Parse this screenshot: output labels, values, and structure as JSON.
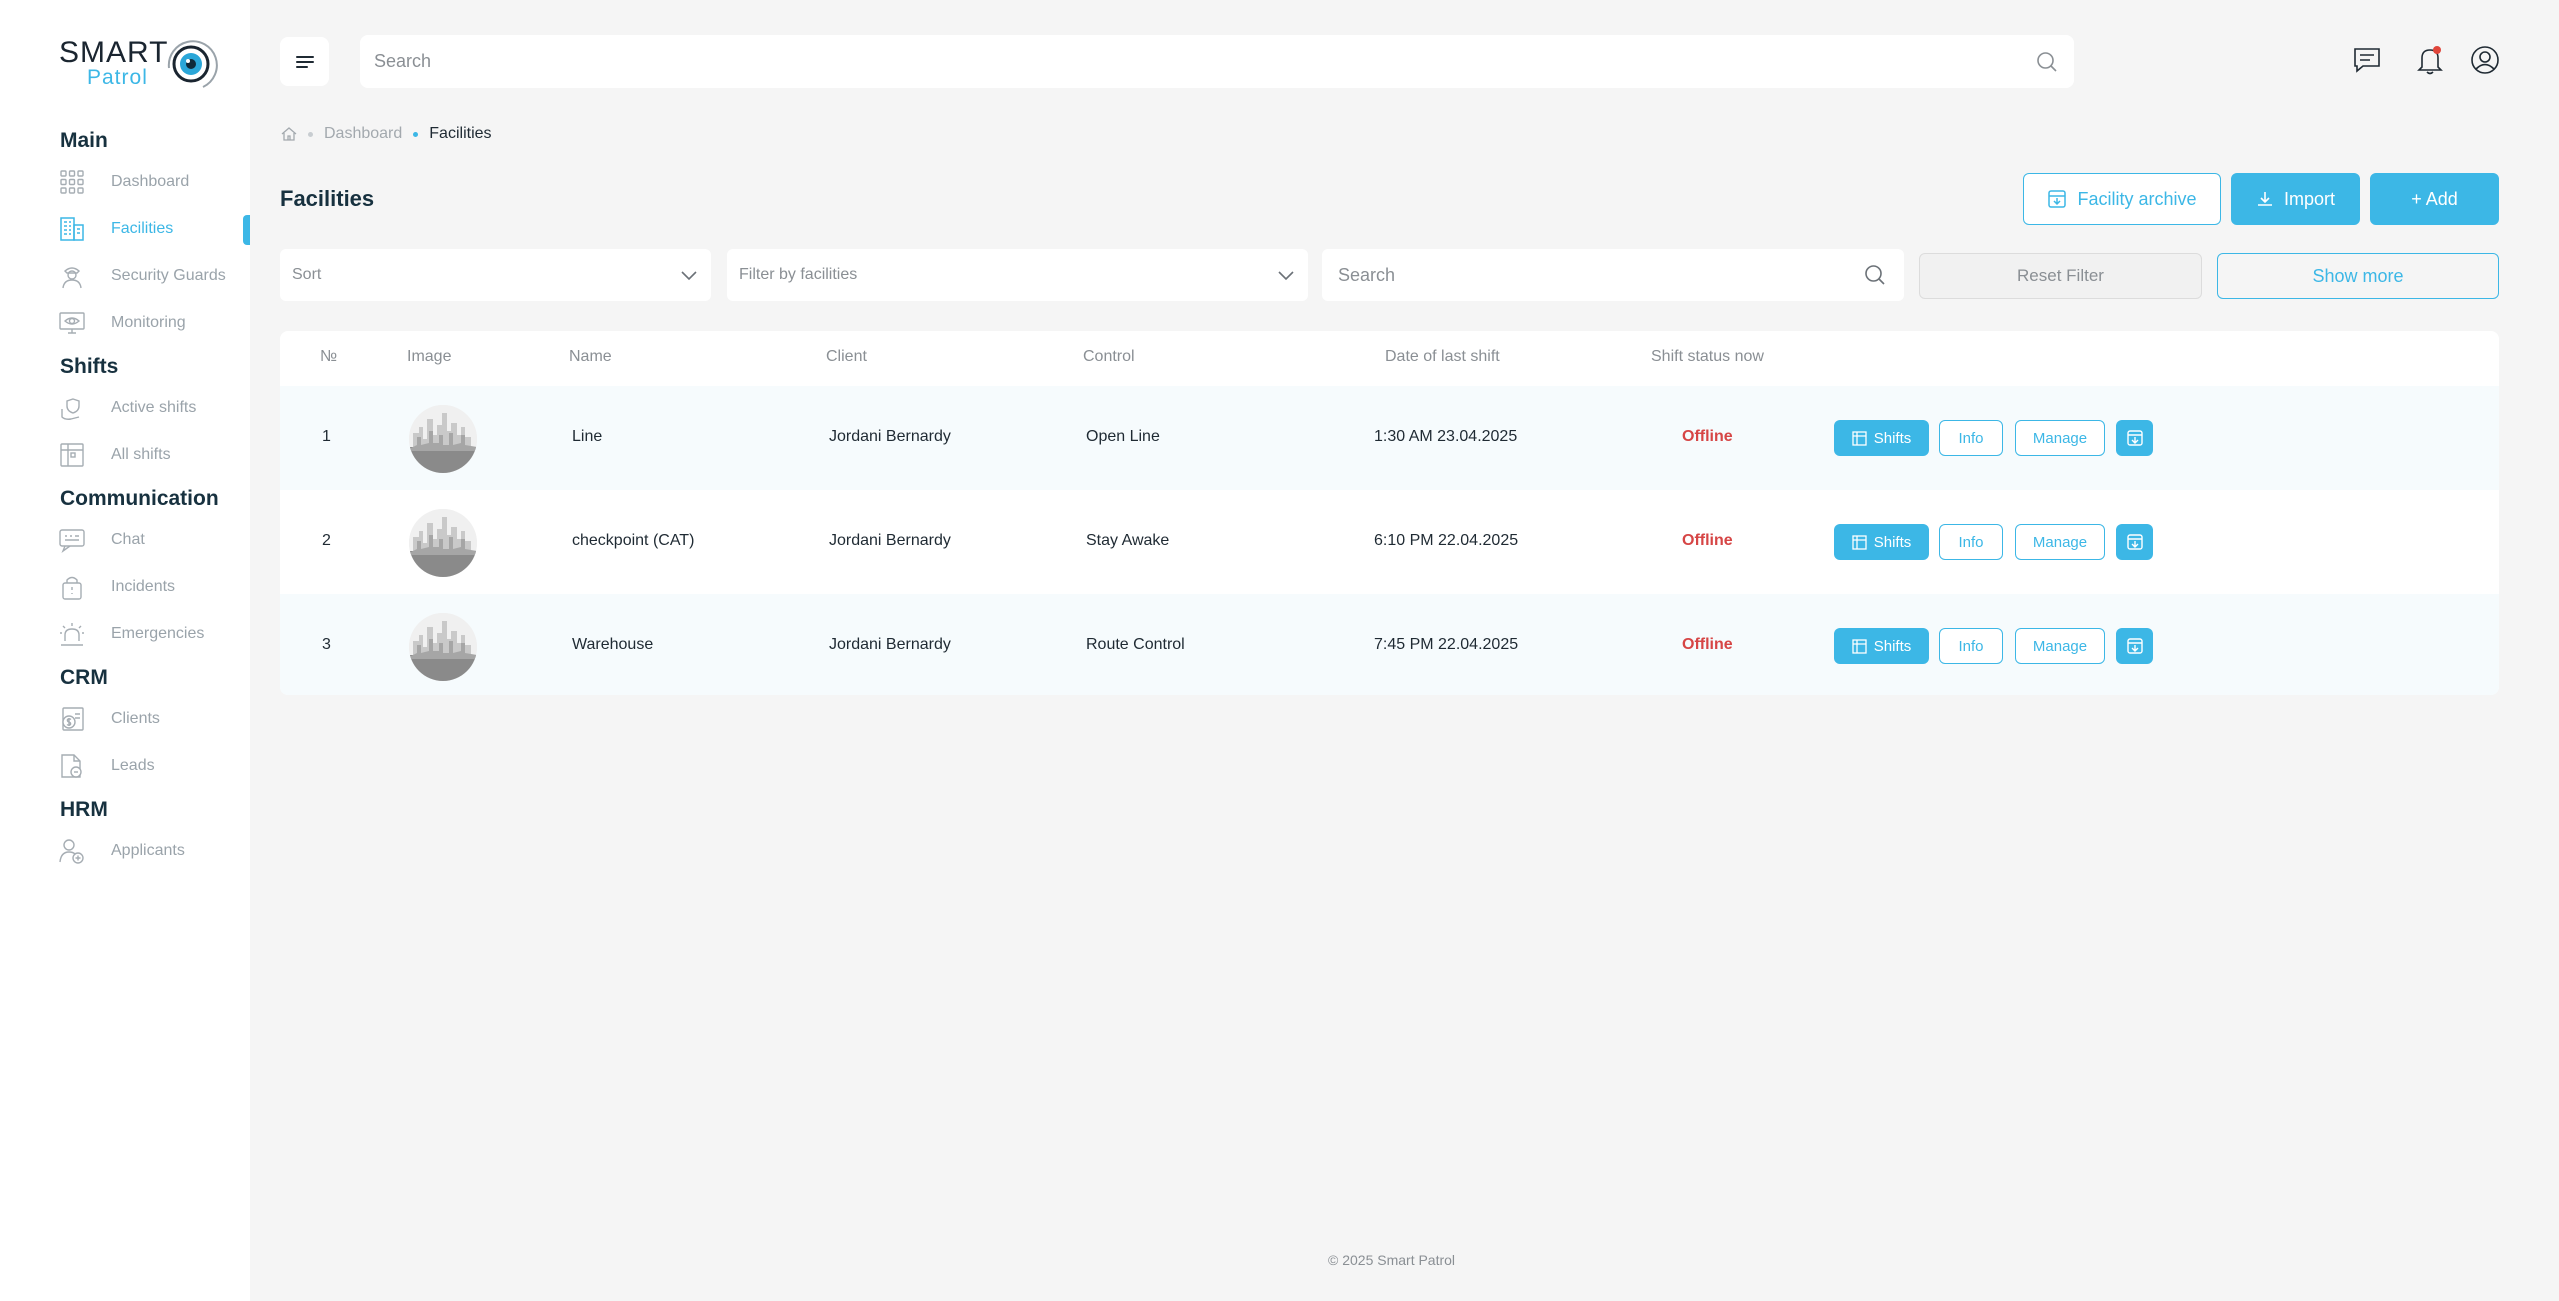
{
  "app": {
    "logo_text_top": "SMART",
    "logo_text_bottom": "Patrol",
    "accent_color": "#3cb7e6",
    "offline_color": "#d64545"
  },
  "sidebar": {
    "sections": [
      {
        "title": "Main",
        "items": [
          {
            "label": "Dashboard",
            "icon": "grid-icon"
          },
          {
            "label": "Facilities",
            "icon": "building-icon",
            "active": true
          },
          {
            "label": "Security Guards",
            "icon": "guard-icon"
          },
          {
            "label": "Monitoring",
            "icon": "monitor-icon"
          }
        ]
      },
      {
        "title": "Shifts",
        "items": [
          {
            "label": "Active shifts",
            "icon": "hand-shield-icon"
          },
          {
            "label": "All shifts",
            "icon": "calendar-icon"
          }
        ]
      },
      {
        "title": "Communication",
        "items": [
          {
            "label": "Chat",
            "icon": "chat-icon"
          },
          {
            "label": "Incidents",
            "icon": "incident-icon"
          },
          {
            "label": "Emergencies",
            "icon": "siren-icon"
          }
        ]
      },
      {
        "title": "CRM",
        "items": [
          {
            "label": "Clients",
            "icon": "money-icon"
          },
          {
            "label": "Leads",
            "icon": "document-icon"
          }
        ]
      },
      {
        "title": "HRM",
        "items": [
          {
            "label": "Applicants",
            "icon": "user-add-icon"
          }
        ]
      }
    ]
  },
  "topbar": {
    "search_placeholder": "Search"
  },
  "breadcrumb": {
    "home_icon": "home-icon",
    "items": [
      "Dashboard",
      "Facilities"
    ]
  },
  "page": {
    "title": "Facilities",
    "archive_label": "Facility archive",
    "import_label": "Import",
    "add_label": "+ Add"
  },
  "filters": {
    "sort_value": "Sort",
    "facilities_value": "Filter by facilities",
    "search_placeholder": "Search",
    "reset_label": "Reset Filter",
    "show_more_label": "Show more"
  },
  "table": {
    "columns": [
      "№",
      "Image",
      "Name",
      "Client",
      "Control",
      "Date of last shift",
      "Shift status now"
    ],
    "rows": [
      {
        "num": "1",
        "name": "Line",
        "client": "Jordani Bernardy",
        "control": "Open Line",
        "date": "1:30 AM 23.04.2025",
        "status": "Offline"
      },
      {
        "num": "2",
        "name": "checkpoint (CAT)",
        "client": "Jordani Bernardy",
        "control": "Stay Awake",
        "date": "6:10 PM 22.04.2025",
        "status": "Offline"
      },
      {
        "num": "3",
        "name": "Warehouse",
        "client": "Jordani Bernardy",
        "control": "Route Control",
        "date": "7:45 PM 22.04.2025",
        "status": "Offline"
      }
    ],
    "actions": {
      "shifts": "Shifts",
      "info": "Info",
      "manage": "Manage"
    }
  },
  "footer": {
    "text": "© 2025 Smart Patrol"
  }
}
